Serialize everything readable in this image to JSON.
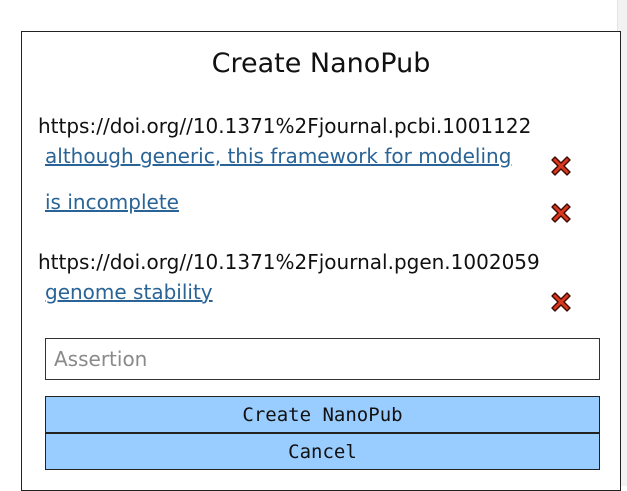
{
  "dialog": {
    "title": "Create NanoPub",
    "sources": [
      {
        "url": "https://doi.org//10.1371%2Fjournal.pcbi.1001122",
        "highlights": [
          "although generic, this framework for modeling",
          "is incomplete"
        ]
      },
      {
        "url": "https://doi.org//10.1371%2Fjournal.pgen.1002059",
        "highlights": [
          "genome stability"
        ]
      }
    ],
    "assertion_placeholder": "Assertion",
    "assertion_value": "",
    "create_label": "Create NanoPub",
    "cancel_label": "Cancel"
  },
  "colors": {
    "button_bg": "#99ccff",
    "link": "#2a6496",
    "delete_icon": "#d9381e"
  }
}
